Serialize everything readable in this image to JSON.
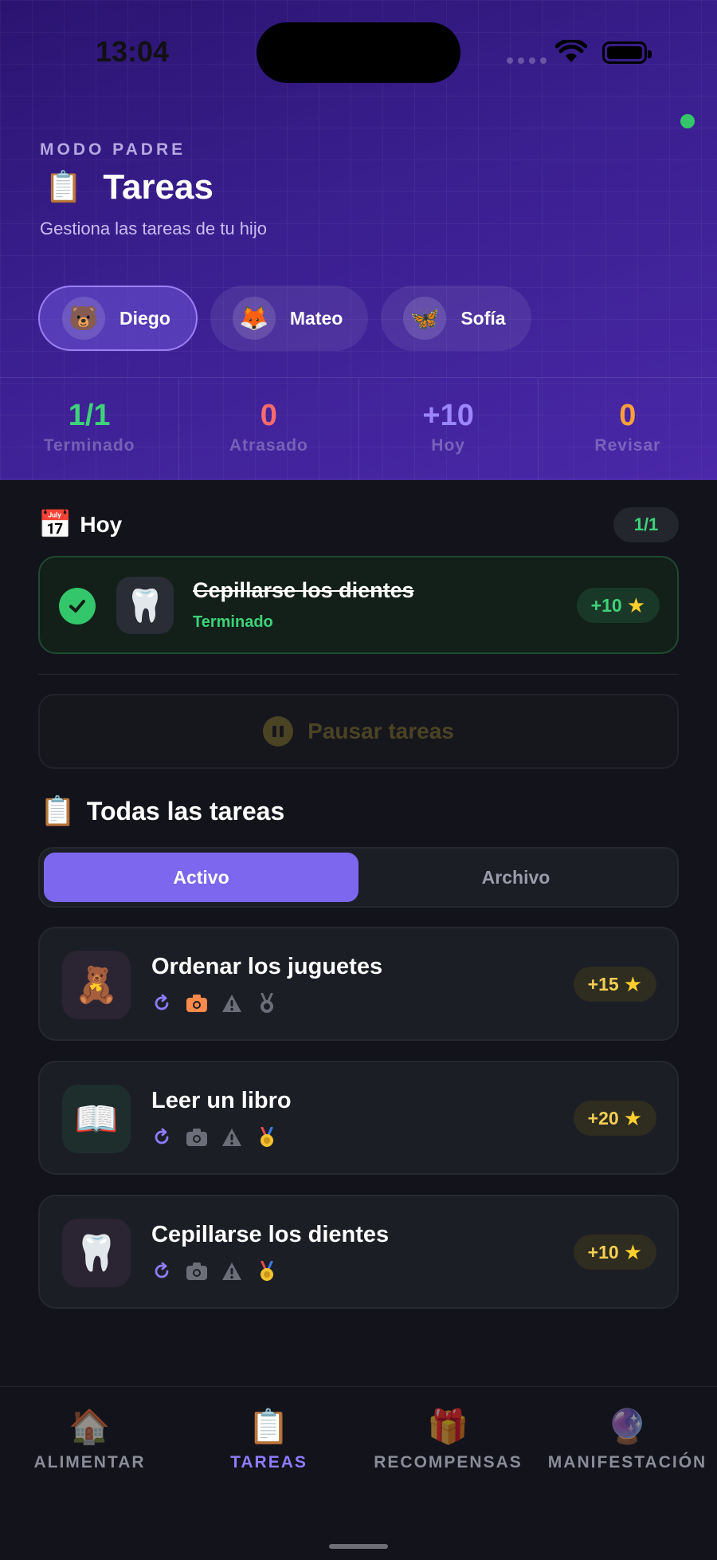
{
  "status_bar": {
    "time": "13:04"
  },
  "header": {
    "mode_label": "MODO PADRE",
    "title_icon": "📋",
    "title": "Tareas",
    "subtitle": "Gestiona las tareas de tu hijo"
  },
  "kids": [
    {
      "name": "Diego",
      "emoji": "🐻",
      "active": true
    },
    {
      "name": "Mateo",
      "emoji": "🦊",
      "active": false
    },
    {
      "name": "Sofía",
      "emoji": "🦋",
      "active": false
    }
  ],
  "stats": [
    {
      "value": "1/1",
      "label": "Terminado",
      "color": "#3ed27a"
    },
    {
      "value": "0",
      "label": "Atrasado",
      "color": "#ff6b6b"
    },
    {
      "value": "+10",
      "label": "Hoy",
      "color": "#9b86ff"
    },
    {
      "value": "0",
      "label": "Revisar",
      "color": "#ff9f3a"
    }
  ],
  "today": {
    "icon": "📅",
    "title": "Hoy",
    "badge": "1/1",
    "task": {
      "name": "Cepillarse los dientes",
      "status": "Terminado",
      "points": "+10",
      "emoji": "🦷"
    }
  },
  "pause_button": {
    "label": "Pausar tareas"
  },
  "all_tasks": {
    "icon": "📋",
    "title": "Todas las tareas",
    "tabs": [
      {
        "label": "Activo",
        "active": true
      },
      {
        "label": "Archivo",
        "active": false
      }
    ],
    "items": [
      {
        "name": "Ordenar los juguetes",
        "emoji": "🧸",
        "points": "+15",
        "icon_bg": "#2b2433",
        "photo_required": true,
        "bonus_active": false
      },
      {
        "name": "Leer un libro",
        "emoji": "📖",
        "points": "+20",
        "icon_bg": "#1d2e2c",
        "photo_required": false,
        "bonus_active": true
      },
      {
        "name": "Cepillarse los dientes",
        "emoji": "🦷",
        "points": "+10",
        "icon_bg": "#2b2433",
        "photo_required": false,
        "bonus_active": true
      }
    ]
  },
  "icons": {
    "repeat": "repeat-icon",
    "camera": "camera-icon",
    "warning": "warning-icon",
    "medal": "medal-icon",
    "star": "star-icon"
  },
  "tabbar": [
    {
      "label": "ALIMENTAR",
      "emoji": "🏠",
      "active": false
    },
    {
      "label": "TAREAS",
      "emoji": "📋",
      "active": true
    },
    {
      "label": "RECOMPENSAS",
      "emoji": "🎁",
      "active": false
    },
    {
      "label": "MANIFESTACIÓN",
      "emoji": "🔮",
      "active": false
    }
  ]
}
